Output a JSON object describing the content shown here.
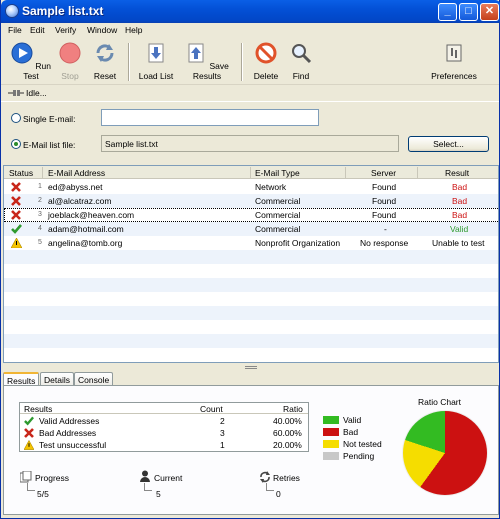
{
  "window": {
    "title": "Sample list.txt",
    "btn_min": "_",
    "btn_max": "□",
    "btn_close": "✕"
  },
  "menu": [
    "File",
    "Edit",
    "Verify",
    "Window",
    "Help"
  ],
  "toolbar": {
    "run_test": "Run Test",
    "stop": "Stop",
    "reset": "Reset",
    "load_list": "Load List",
    "save_results": "Save Results",
    "delete": "Delete",
    "find": "Find",
    "preferences": "Preferences"
  },
  "status": {
    "text": "Idle..."
  },
  "form": {
    "single_label": "Single E-mail:",
    "single_value": "",
    "list_label": "E-Mail list file:",
    "list_value": "Sample list.txt",
    "select_button": "Select..."
  },
  "grid": {
    "columns": [
      "Status",
      "E-Mail Address",
      "E-Mail Type",
      "Server",
      "Result"
    ],
    "rows": [
      {
        "num": "1",
        "status_icon": "x-icon",
        "email": "ed@abyss.net",
        "type": "Network",
        "server": "Found",
        "result": "Bad"
      },
      {
        "num": "2",
        "status_icon": "x-icon",
        "email": "al@alcatraz.com",
        "type": "Commercial",
        "server": "Found",
        "result": "Bad"
      },
      {
        "num": "3",
        "status_icon": "x-icon",
        "email": "joeblack@heaven.com",
        "type": "Commercial",
        "server": "Found",
        "result": "Bad"
      },
      {
        "num": "4",
        "status_icon": "check-icon",
        "email": "adam@hotmail.com",
        "type": "Commercial",
        "server": "-",
        "result": "Valid"
      },
      {
        "num": "5",
        "status_icon": "warning-icon",
        "email": "angelina@tomb.org",
        "type": "Nonprofit Organization",
        "server": "No response",
        "result": "Unable to test"
      }
    ]
  },
  "tabs": [
    "Results",
    "Details",
    "Console"
  ],
  "results": {
    "headers": {
      "name": "Results",
      "count": "Count",
      "ratio": "Ratio"
    },
    "rows": [
      {
        "label": "Valid Addresses",
        "count": "2",
        "ratio": "40.00%"
      },
      {
        "label": "Bad Addresses",
        "count": "3",
        "ratio": "60.00%"
      },
      {
        "label": "Test unsuccessful",
        "count": "1",
        "ratio": "20.00%"
      }
    ],
    "legend": [
      "Valid",
      "Bad",
      "Not tested",
      "Pending"
    ],
    "ratio_title": "Ratio Chart"
  },
  "stats": {
    "progress_label": "Progress",
    "progress_value": "5/5",
    "current_label": "Current",
    "current_value": "5",
    "retries_label": "Retries",
    "retries_value": "0"
  },
  "colors": {
    "bad": "#cc1111",
    "valid": "#33bb22",
    "not_tested": "#f5dd00",
    "pending": "#c8c8c8",
    "title_bar": "#0350d6"
  },
  "chart_data": {
    "type": "pie",
    "title": "Ratio Chart",
    "categories": [
      "Bad",
      "Not tested",
      "Valid"
    ],
    "values": [
      3,
      1,
      1
    ]
  }
}
